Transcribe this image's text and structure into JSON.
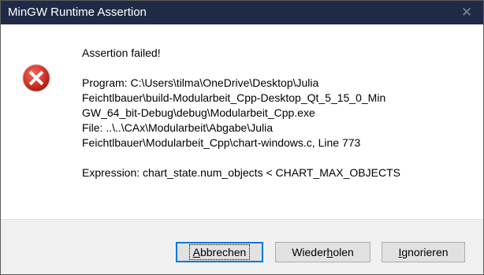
{
  "window": {
    "title": "MinGW Runtime Assertion",
    "close_glyph": "✕",
    "titlebar_color": "#1f2b46"
  },
  "icon": {
    "name": "error-icon",
    "color": "#c42b1c"
  },
  "message": {
    "heading": "Assertion failed!",
    "program_lines": [
      "Program: C:\\Users\\tilma\\OneDrive\\Desktop\\Julia",
      "Feichtlbauer\\build-Modularbeit_Cpp-Desktop_Qt_5_15_0_Min",
      "GW_64_bit-Debug\\debug\\Modularbeit_Cpp.exe"
    ],
    "file_lines": [
      "File: ..\\..\\CAx\\Modularbeit\\Abgabe\\Julia",
      "Feichtlbauer\\Modularbeit_Cpp\\chart-windows.c, Line 773"
    ],
    "expression": "Expression: chart_state.num_objects < CHART_MAX_OBJECTS"
  },
  "buttons": {
    "abort": {
      "before": "",
      "mnemonic": "A",
      "after": "bbrechen"
    },
    "retry": {
      "before": "Wieder",
      "mnemonic": "h",
      "after": "olen"
    },
    "ignore": {
      "before": "",
      "mnemonic": "I",
      "after": "gnorieren"
    }
  }
}
